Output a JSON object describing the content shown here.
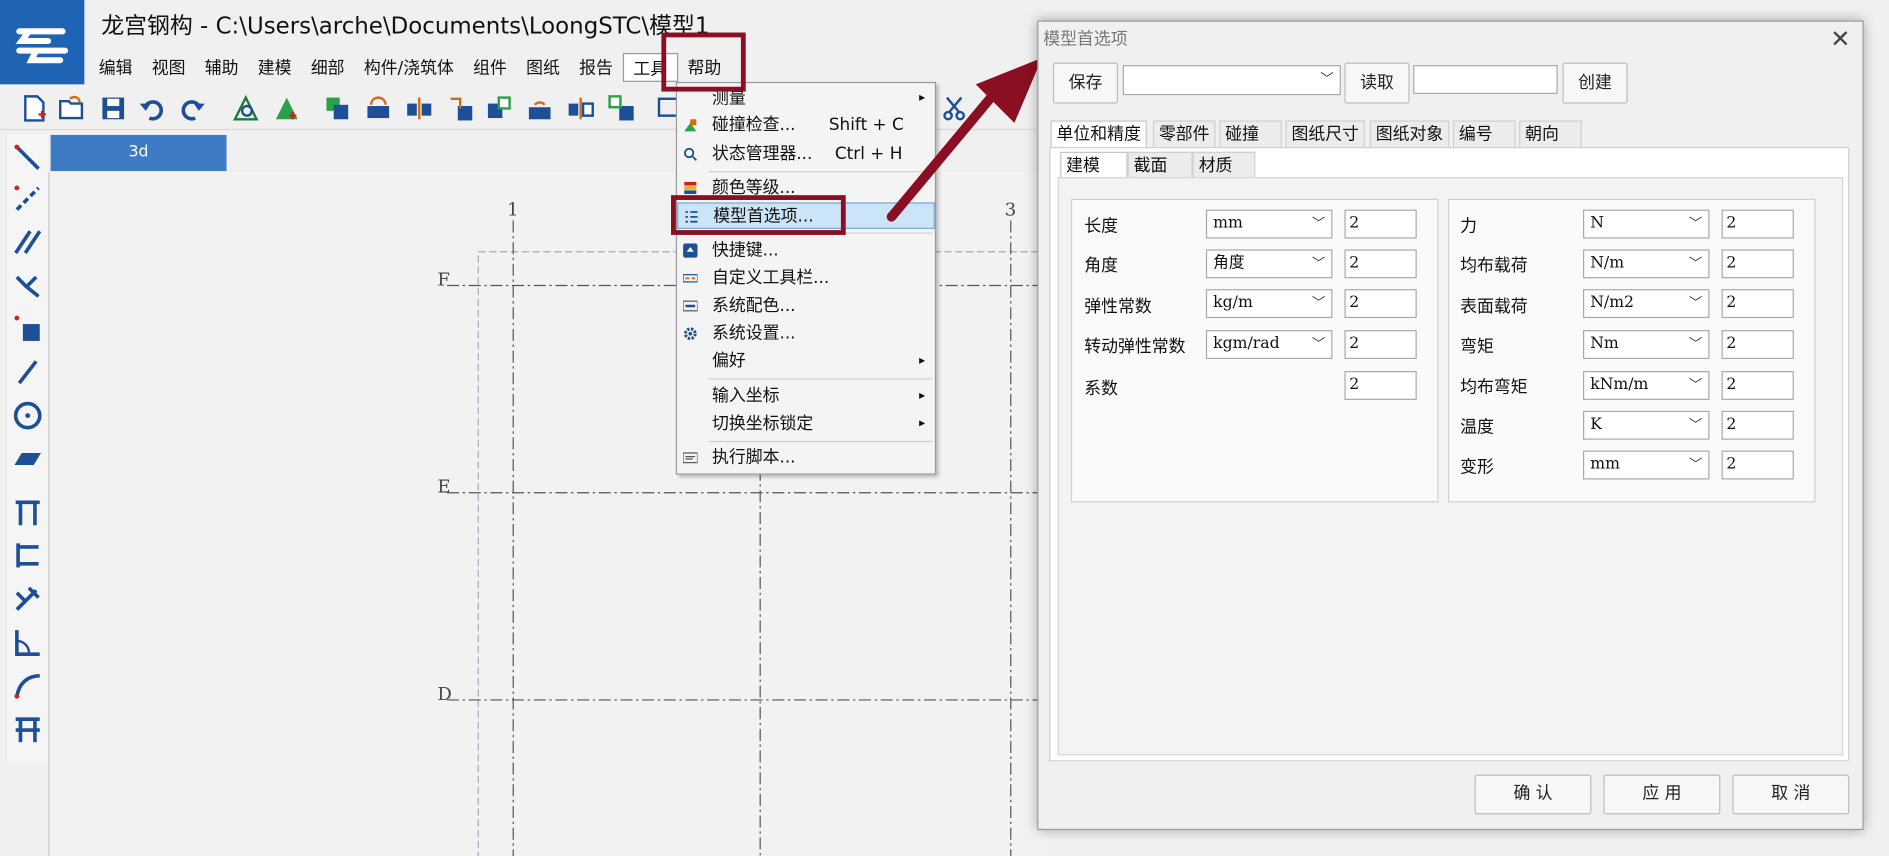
{
  "app": {
    "title": "龙宫钢构 - C:\\Users\\arche\\Documents\\LoongSTC\\模型1",
    "menus": [
      "编辑",
      "视图",
      "辅助",
      "建模",
      "细部",
      "构件/浇筑体",
      "组件",
      "图纸",
      "报告",
      "工具",
      "帮助"
    ],
    "view_tab": "3d",
    "grid_labels": {
      "col1": "1",
      "col3": "3",
      "rowF": "F",
      "rowE": "E",
      "rowD": "D"
    }
  },
  "tools_menu": {
    "items": [
      {
        "label": "测量",
        "shortcut": "",
        "submenu": true
      },
      {
        "label": "碰撞检查...",
        "shortcut": "Shift + C",
        "submenu": false
      },
      {
        "label": "状态管理器...",
        "shortcut": "Ctrl + H",
        "submenu": false
      },
      {
        "label": "颜色等级...",
        "shortcut": "",
        "submenu": false
      },
      {
        "label": "模型首选项...",
        "shortcut": "",
        "submenu": false,
        "highlighted": true
      },
      {
        "label": "快捷键...",
        "shortcut": "",
        "submenu": false
      },
      {
        "label": "自定义工具栏...",
        "shortcut": "",
        "submenu": false
      },
      {
        "label": "系统配色...",
        "shortcut": "",
        "submenu": false
      },
      {
        "label": "系统设置...",
        "shortcut": "",
        "submenu": false
      },
      {
        "label": "偏好",
        "shortcut": "",
        "submenu": true
      },
      {
        "label": "输入坐标",
        "shortcut": "",
        "submenu": true
      },
      {
        "label": "切换坐标锁定",
        "shortcut": "",
        "submenu": true
      },
      {
        "label": "执行脚本...",
        "shortcut": "",
        "submenu": false
      }
    ]
  },
  "dialog": {
    "title": "模型首选项",
    "save_label": "保存",
    "preset_value": "",
    "read_label": "读取",
    "create_name_value": "",
    "create_label": "创建",
    "tabs": [
      "单位和精度",
      "零部件",
      "碰撞",
      "图纸尺寸",
      "图纸对象",
      "编号",
      "朝向"
    ],
    "subtabs": [
      "建模",
      "截面",
      "材质"
    ],
    "left_rows": [
      {
        "label": "长度",
        "unit": "mm",
        "precision": "2"
      },
      {
        "label": "角度",
        "unit": "角度",
        "precision": "2"
      },
      {
        "label": "弹性常数",
        "unit": "kg/m",
        "precision": "2"
      },
      {
        "label": "转动弹性常数",
        "unit": "kgm/rad",
        "precision": "2"
      },
      {
        "label": "系数",
        "unit": "",
        "precision": "2"
      }
    ],
    "right_rows": [
      {
        "label": "力",
        "unit": "N",
        "precision": "2"
      },
      {
        "label": "均布载荷",
        "unit": "N/m",
        "precision": "2"
      },
      {
        "label": "表面载荷",
        "unit": "N/m2",
        "precision": "2"
      },
      {
        "label": "弯矩",
        "unit": "Nm",
        "precision": "2"
      },
      {
        "label": "均布弯矩",
        "unit": "kNm/m",
        "precision": "2"
      },
      {
        "label": "温度",
        "unit": "K",
        "precision": "2"
      },
      {
        "label": "变形",
        "unit": "mm",
        "precision": "2"
      }
    ],
    "ok_label": "确 认",
    "apply_label": "应 用",
    "cancel_label": "取 消"
  },
  "colors": {
    "accent": "#1e63b4",
    "annotation": "#8a0f22",
    "highlight": "#cce4f7"
  }
}
